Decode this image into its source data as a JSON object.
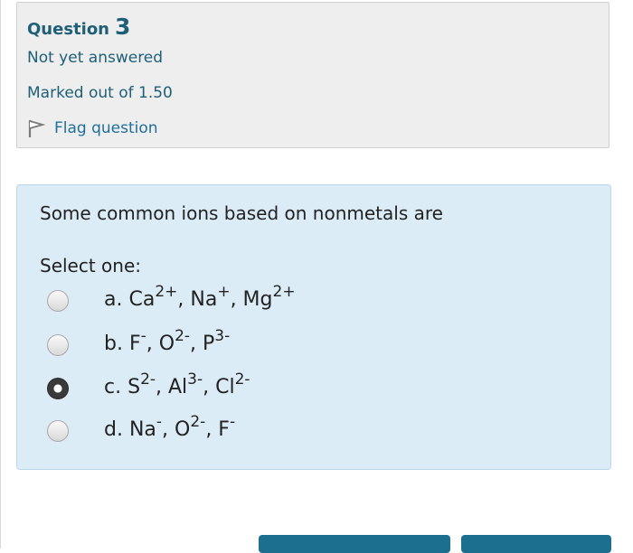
{
  "info": {
    "question_word": "Question",
    "question_number": "3",
    "state": "Not yet answered",
    "grade": "Marked out of 1.50",
    "flag_label": "Flag question"
  },
  "question": {
    "text": "Some common ions based on nonmetals are",
    "prompt": "Select one:",
    "selected_index": 2,
    "options": [
      {
        "letter": "a.",
        "html": "Ca<sup>2+</sup>, Na<sup>+</sup>, Mg<sup>2+</sup>",
        "plain": "Ca2+, Na+, Mg2+"
      },
      {
        "letter": "b.",
        "html": "F<sup>-</sup>, O<sup>2-</sup>, P<sup>3-</sup>",
        "plain": "F-, O2-, P3-"
      },
      {
        "letter": "c.",
        "html": "S<sup>2-</sup>, Al<sup>3-</sup>, Cl<sup>2-</sup>",
        "plain": "S2-, Al3-, Cl2-"
      },
      {
        "letter": "d.",
        "html": "Na<sup>-</sup>, O<sup>2-</sup>, F<sup>-</sup>",
        "plain": "Na-, O2-, F-"
      }
    ]
  },
  "colors": {
    "accent": "#1f5f78",
    "formulation_bg": "#dcecf7",
    "info_bg": "#eeeeee",
    "button": "#1d6f90"
  }
}
